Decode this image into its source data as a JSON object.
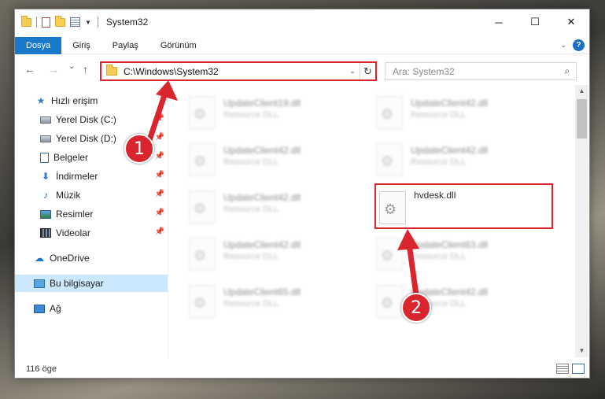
{
  "window": {
    "title": "System32"
  },
  "window_controls": {
    "minimize": "─",
    "maximize": "☐",
    "close": "✕"
  },
  "ribbon": {
    "tabs": [
      "Dosya",
      "Giriş",
      "Paylaş",
      "Görünüm"
    ],
    "active_tab": "Dosya",
    "help": "?"
  },
  "nav": {
    "back": "←",
    "forward": "→",
    "recent": "⌄",
    "up": "↑"
  },
  "address": {
    "path": "C:\\Windows\\System32",
    "refresh": "↻",
    "dropdown": "⌄"
  },
  "search": {
    "placeholder": "Ara: System32"
  },
  "sidebar": {
    "items": [
      {
        "label": "Hızlı erişim",
        "icon": "star-icon",
        "pinned": false
      },
      {
        "label": "Yerel Disk (C:)",
        "icon": "disk-icon",
        "pinned": true
      },
      {
        "label": "Yerel Disk (D:)",
        "icon": "disk-icon",
        "pinned": true
      },
      {
        "label": "Belgeler",
        "icon": "documents-icon",
        "pinned": true
      },
      {
        "label": "İndirmeler",
        "icon": "downloads-icon",
        "pinned": true
      },
      {
        "label": "Müzik",
        "icon": "music-icon",
        "pinned": true
      },
      {
        "label": "Resimler",
        "icon": "pictures-icon",
        "pinned": true
      },
      {
        "label": "Videolar",
        "icon": "videos-icon",
        "pinned": true
      },
      {
        "label": "OneDrive",
        "icon": "cloud-icon",
        "pinned": false
      },
      {
        "label": "Bu bilgisayar",
        "icon": "computer-icon",
        "pinned": false,
        "selected": true
      },
      {
        "label": "Ağ",
        "icon": "network-icon",
        "pinned": false
      }
    ]
  },
  "files": [
    {
      "name": "UpdateClient19.dll",
      "type": "Resource DLL"
    },
    {
      "name": "UpdateClient42.dll",
      "type": "Resource DLL"
    },
    {
      "name": "UpdateClient42.dll",
      "type": "Resource DLL"
    },
    {
      "name": "UpdateClient42.dll",
      "type": "Resource DLL"
    },
    {
      "name": "UpdateClient42.dll",
      "type": "Resource DLL"
    },
    {
      "name": "hvdesk.dll",
      "type": "",
      "highlighted": true
    },
    {
      "name": "UpdateClient42.dll",
      "type": "Resource DLL"
    },
    {
      "name": "UpdateClient63.dll",
      "type": "Resource DLL"
    },
    {
      "name": "UpdateClient65.dll",
      "type": "Resource DLL"
    },
    {
      "name": "UpdateClient42.dll",
      "type": "Resource DLL"
    }
  ],
  "status": {
    "item_count": "116 öge"
  },
  "annotations": {
    "step1": "1",
    "step2": "2"
  },
  "colors": {
    "accent": "#1979ca",
    "highlight": "#d9262e",
    "selected": "#cce8ff"
  }
}
